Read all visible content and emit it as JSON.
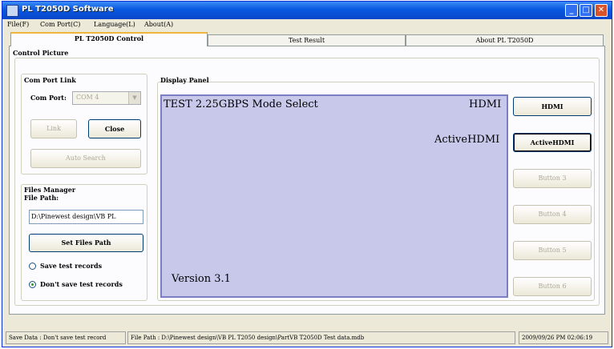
{
  "window": {
    "title": "PL T2050D Software"
  },
  "menu": {
    "file": "File(F)",
    "comport": "Com Port(C)",
    "language": "Language(L)",
    "about": "About(A)"
  },
  "tabs": [
    {
      "label": "PL T2050D Control"
    },
    {
      "label": "Test Result"
    },
    {
      "label": "About PL T2050D"
    }
  ],
  "control": {
    "section_label": "Control Picture",
    "comport": {
      "title": "Com Port Link",
      "port_label": "Com Port:",
      "port_value": "COM 4",
      "link_label": "Link",
      "close_label": "Close",
      "auto_search_label": "Auto Search"
    },
    "files": {
      "title": "Files Manager",
      "path_label": "File Path:",
      "path_value": "D:\\Pinewest design\\VB PL",
      "set_button": "Set Files Path",
      "radio_save": "Save test records",
      "radio_dont_save": "Don't save test records"
    },
    "display": {
      "title": "Display Panel",
      "line1": "TEST  2.25GBPS  Mode  Select",
      "mode_hdmi": "HDMI",
      "mode_active": "ActiveHDMI",
      "version": "Version 3.1"
    },
    "buttons": [
      "HDMI",
      "ActiveHDMI",
      "Button 3",
      "Button 4",
      "Button 5",
      "Button 6"
    ]
  },
  "status": {
    "save_data": "Save Data : Don't save test record",
    "file_path": "File Path : D:\\Pinewest design\\VB PL T2050 design\\PartVB T2050D Test data.mdb",
    "datetime": "2009/09/26 PM 02:06:19"
  }
}
